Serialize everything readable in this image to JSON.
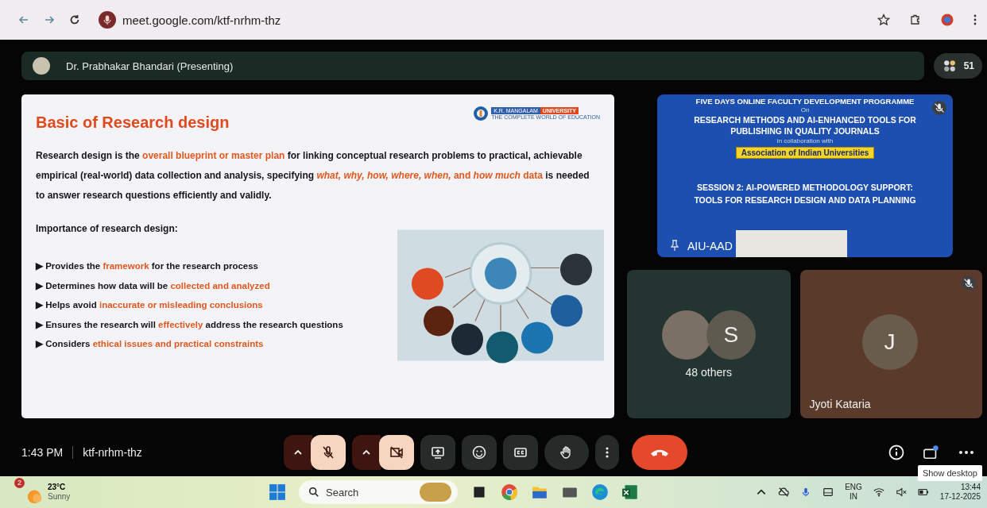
{
  "browser": {
    "url": "meet.google.com/ktf-nrhm-thz"
  },
  "presenter_bar": {
    "title": "Dr. Prabhakar Bhandari (Presenting)",
    "participants": "51"
  },
  "slide": {
    "title": "Basic of Research design",
    "logo_name": "K.R. MANGALAM",
    "logo_university": "UNIVERSITY",
    "logo_tagline": "THE COMPLETE WORLD OF EDUCATION",
    "paragraph": [
      {
        "text": "Research design is the ",
        "highlight": false
      },
      {
        "text": "overall blueprint or master plan",
        "highlight": true
      },
      {
        "text": " for linking conceptual research problems to practical, achievable empirical (real-world) data collection and analysis, specifying ",
        "highlight": false
      },
      {
        "text": "*what, why, how, where, when,* and *how much* data",
        "highlight": true
      },
      {
        "text": " is needed to answer research questions efficiently and validly.",
        "highlight": false
      }
    ],
    "subheading": "Importance of research design:",
    "bullets": [
      {
        "marker": "▶",
        "segments": [
          {
            "text": "Provides the ",
            "highlight": false
          },
          {
            "text": "framework",
            "highlight": true
          },
          {
            "text": " for the research process",
            "highlight": false
          }
        ]
      },
      {
        "marker": "▶",
        "segments": [
          {
            "text": "Determines how data will be ",
            "highlight": false
          },
          {
            "text": "collected and analyzed",
            "highlight": true
          }
        ]
      },
      {
        "marker": "▶",
        "segments": [
          {
            "text": "Helps avoid ",
            "highlight": false
          },
          {
            "text": "inaccurate or misleading conclusions",
            "highlight": true
          }
        ]
      },
      {
        "marker": "▶",
        "segments": [
          {
            "text": "Ensures the research will ",
            "highlight": false
          },
          {
            "text": "effectively",
            "highlight": true
          },
          {
            "text": " address the research questions",
            "highlight": false
          }
        ]
      },
      {
        "marker": "▶",
        "segments": [
          {
            "text": "Considers ",
            "highlight": false
          },
          {
            "text": "ethical issues and practical constraints",
            "highlight": true
          }
        ]
      }
    ]
  },
  "banner_tile": {
    "line1": "FIVE DAYS ONLINE FACULTY DEVELOPMENT PROGRAMME",
    "line2": "On",
    "title": "RESEARCH METHODS AND AI-ENHANCED TOOLS FOR PUBLISHING IN QUALITY JOURNALS",
    "collab": "in collaboration with",
    "partner": "Association of Indian Universities",
    "session": "SESSION 2: AI-POWERED METHODOLOGY SUPPORT: TOOLS FOR RESEARCH DESIGN AND DATA PLANNING",
    "name": "AIU-AAD",
    "muted": true
  },
  "tiles": [
    {
      "kind": "group",
      "initial": "S",
      "label": "48 others",
      "muted": false
    },
    {
      "kind": "person",
      "initial": "J",
      "label": "Jyoti Kataria",
      "muted": true
    }
  ],
  "meeting_bar": {
    "time": "1:43 PM",
    "code": "ktf-nrhm-thz",
    "controls": [
      {
        "kind": "caret",
        "off": true
      },
      {
        "kind": "mic",
        "off": true
      },
      {
        "kind": "caret",
        "off": true
      },
      {
        "kind": "camera",
        "off": true
      },
      {
        "kind": "present"
      },
      {
        "kind": "emoji"
      },
      {
        "kind": "captions"
      },
      {
        "kind": "hand"
      },
      {
        "kind": "more"
      },
      {
        "kind": "hangup"
      }
    ],
    "tooltip": "Show desktop"
  },
  "taskbar": {
    "weather_badge": "2",
    "temperature": "23°C",
    "condition": "Sunny",
    "search": "Search",
    "language": "ENG",
    "region": "IN",
    "time": "13:44",
    "date": "17-12-2025"
  }
}
